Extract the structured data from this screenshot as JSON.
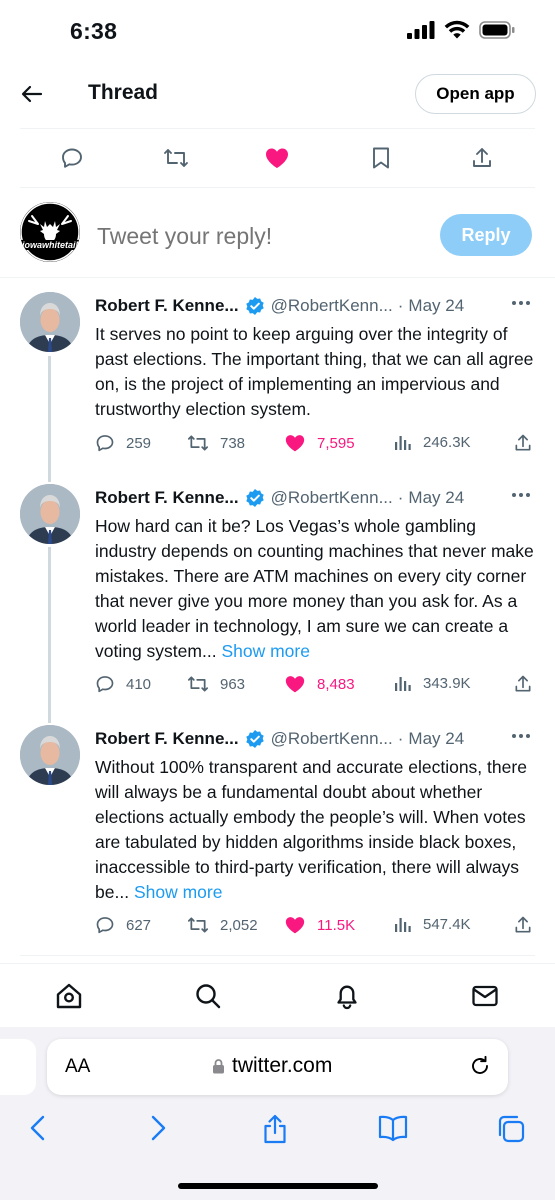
{
  "status_bar": {
    "time": "6:38"
  },
  "header": {
    "title": "Thread",
    "open_app": "Open app"
  },
  "action_bar": {
    "icons": [
      "reply-icon",
      "retweet-icon",
      "like-icon",
      "bookmark-icon",
      "share-icon"
    ],
    "liked_color": "#f91880"
  },
  "reply_box": {
    "placeholder": "Tweet your reply!",
    "button": "Reply",
    "avatar_text": "iowawhitetail"
  },
  "tweets": [
    {
      "name": "Robert F. Kenne...",
      "handle": "@RobertKenn...",
      "dot": "·",
      "date": "May 24",
      "text": "It serves no point to keep arguing over the integrity of past elections. The important thing, that we can all agree on, is the project of implementing an impervious and trustworthy election system.",
      "show_more": "",
      "replies": "259",
      "retweets": "738",
      "likes": "7,595",
      "views": "246.3K"
    },
    {
      "name": "Robert F. Kenne...",
      "handle": "@RobertKenn...",
      "dot": "·",
      "date": "May 24",
      "text": "How hard can it be? Los Vegas’s whole gambling industry depends on counting machines that never make mistakes. There are ATM machines on every city corner that never give you more money than you ask for. As a world leader in technology, I am sure we can create a voting system...",
      "show_more": "Show more",
      "replies": "410",
      "retweets": "963",
      "likes": "8,483",
      "views": "343.9K"
    },
    {
      "name": "Robert F. Kenne...",
      "handle": "@RobertKenn...",
      "dot": "·",
      "date": "May 24",
      "text": "Without 100% transparent and accurate elections, there will always be a fundamental doubt about whether elections actually embody the people’s will. When votes are tabulated by hidden algorithms inside black boxes, inaccessible to third-party verification, there will always be...",
      "show_more": "Show more",
      "replies": "627",
      "retweets": "2,052",
      "likes": "11.5K",
      "views": "547.4K"
    }
  ],
  "bottom_nav": {
    "icons": [
      "home-icon",
      "search-icon",
      "notifications-icon",
      "messages-icon"
    ]
  },
  "browser": {
    "aa_label": "AA",
    "url": "twitter.com"
  },
  "colors": {
    "accent": "#1d9bf0",
    "like": "#f91880",
    "reply_button": "#8ecdf8"
  }
}
